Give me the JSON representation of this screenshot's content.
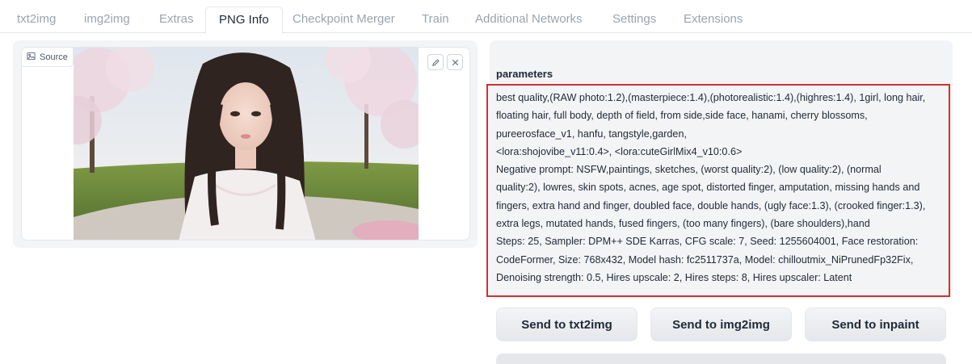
{
  "tabs": [
    {
      "label": "txt2img"
    },
    {
      "label": "img2img"
    },
    {
      "label": "Extras"
    },
    {
      "label": "PNG Info"
    },
    {
      "label": "Checkpoint Merger"
    },
    {
      "label": "Train"
    },
    {
      "label": "Additional Networks"
    },
    {
      "label": "Settings"
    },
    {
      "label": "Extensions"
    }
  ],
  "active_tab": "PNG Info",
  "source": {
    "label": "Source"
  },
  "params": {
    "label": "parameters",
    "text": "best quality,(RAW photo:1.2),(masterpiece:1.4),(photorealistic:1.4),(highres:1.4), 1girl, long hair,\nfloating hair, full body, depth of field, from side,side face, hanami, cherry blossoms,\npureerosface_v1, hanfu, tangstyle,garden,\n<lora:shojovibe_v11:0.4>, <lora:cuteGirlMix4_v10:0.6>\nNegative prompt: NSFW,paintings, sketches, (worst quality:2), (low quality:2), (normal\nquality:2), lowres, skin spots, acnes, age spot, distorted finger, amputation, missing hands and\nfingers, extra hand and finger, doubled face, double hands, (ugly face:1.3), (crooked finger:1.3),\nextra legs, mutated hands, fused fingers, (too many fingers), (bare shoulders),hand\nSteps: 25, Sampler: DPM++ SDE Karras, CFG scale: 7, Seed: 1255604001, Face restoration:\nCodeFormer, Size: 768x432, Model hash: fc2511737a, Model: chilloutmix_NiPrunedFp32Fix,\nDenoising strength: 0.5, Hires upscale: 2, Hires steps: 8, Hires upscaler: Latent"
  },
  "buttons": {
    "send_txt2img": "Send to txt2img",
    "send_img2img": "Send to img2img",
    "send_inpaint": "Send to inpaint"
  },
  "colors": {
    "highlight_border": "#d32f2f",
    "panel_bg": "#f3f4f6",
    "tab_inactive": "#9ca3af"
  },
  "icons": {
    "source": "image-icon",
    "edit": "pencil-icon",
    "clear": "close-icon"
  }
}
